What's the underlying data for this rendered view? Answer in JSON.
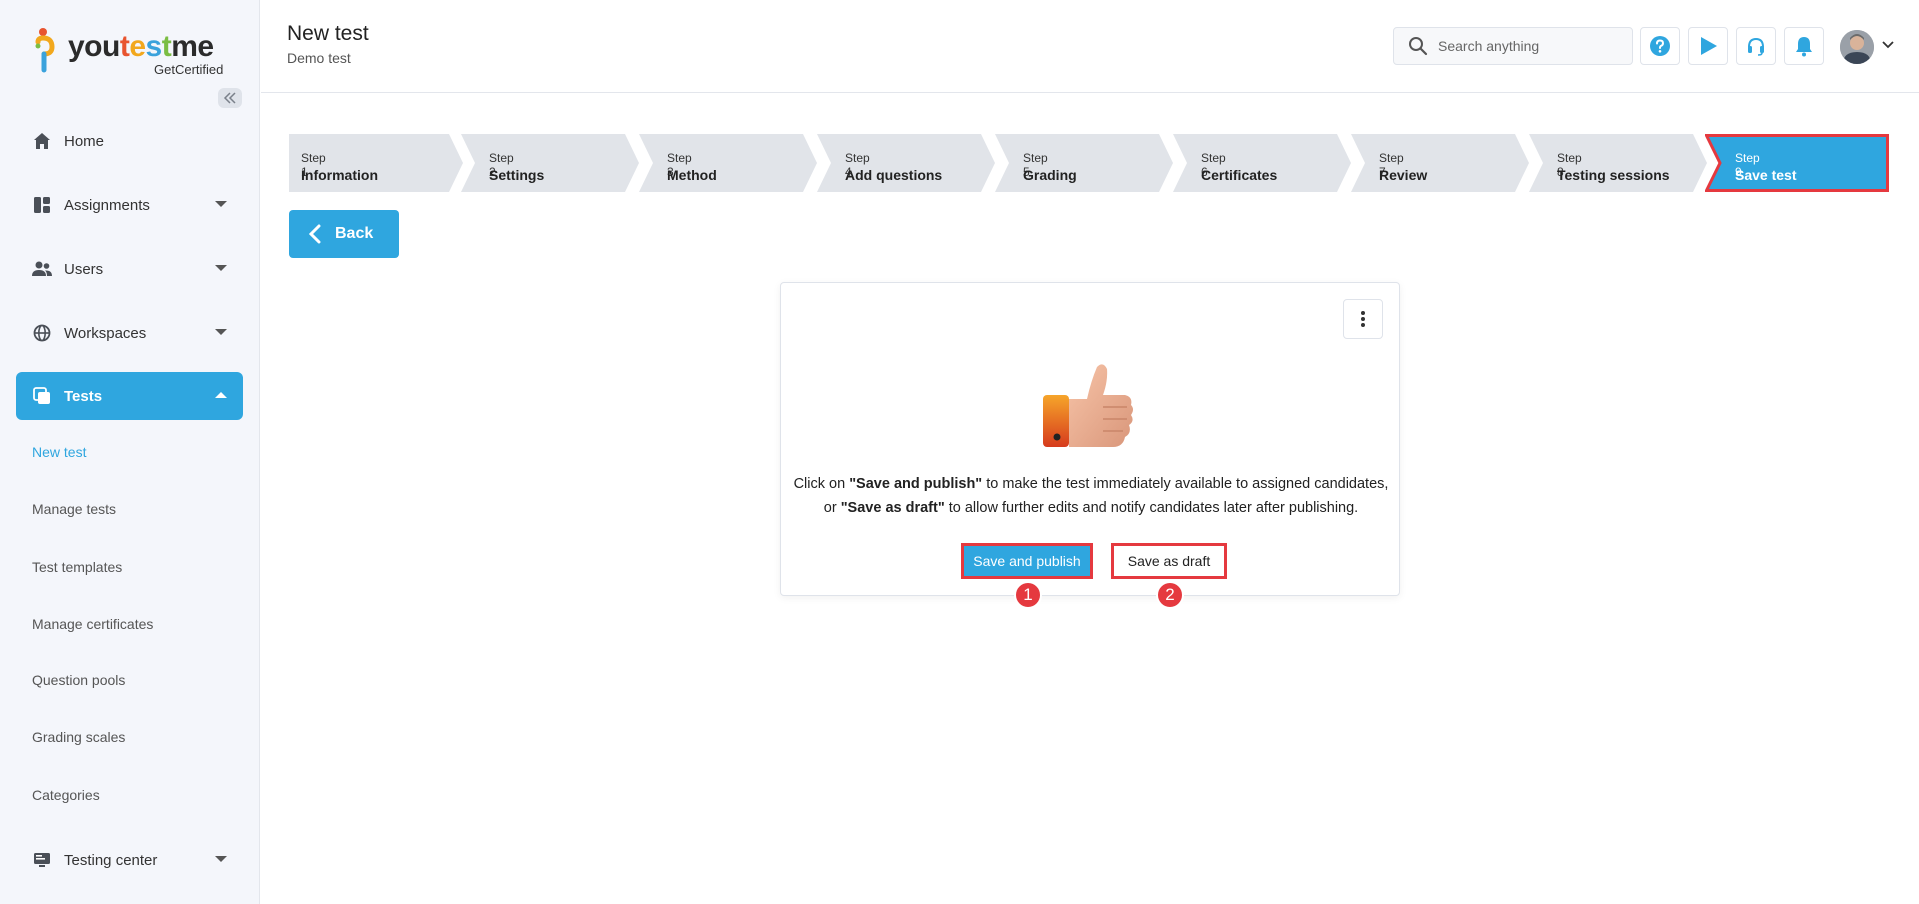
{
  "logo": {
    "text_you": "you",
    "text_t": "t",
    "text_e": "e",
    "text_s": "s",
    "text_t2": "t",
    "text_me": "me",
    "sub": "GetCertified"
  },
  "sidebar": {
    "items": [
      {
        "label": "Home",
        "icon": "home-icon"
      },
      {
        "label": "Assignments",
        "icon": "dashboard-icon"
      },
      {
        "label": "Users",
        "icon": "users-icon"
      },
      {
        "label": "Workspaces",
        "icon": "globe-icon"
      },
      {
        "label": "Tests",
        "icon": "copy-icon"
      },
      {
        "label": "Testing center",
        "icon": "monitor-icon"
      }
    ],
    "sub_items": [
      "New test",
      "Manage tests",
      "Test templates",
      "Manage certificates",
      "Question pools",
      "Grading scales",
      "Categories"
    ]
  },
  "header": {
    "title": "New test",
    "subtitle": "Demo test",
    "search_placeholder": "Search anything"
  },
  "stepper": {
    "steps": [
      {
        "num": "Step 1",
        "label": "Information"
      },
      {
        "num": "Step 2",
        "label": "Settings"
      },
      {
        "num": "Step 3",
        "label": "Method"
      },
      {
        "num": "Step 4",
        "label": "Add questions"
      },
      {
        "num": "Step 5",
        "label": "Grading"
      },
      {
        "num": "Step 6",
        "label": "Certificates"
      },
      {
        "num": "Step 7",
        "label": "Review"
      },
      {
        "num": "Step 8",
        "label": "Testing sessions"
      },
      {
        "num": "Step 9",
        "label": "Save test"
      }
    ],
    "active_index": 8
  },
  "back_label": "Back",
  "card": {
    "line1_pre": "Click on ",
    "line1_bold": "\"Save and publish\"",
    "line1_post": " to make the test immediately available to assigned candidates,",
    "line2_pre": "or ",
    "line2_bold": "\"Save as draft\"",
    "line2_post": " to allow further edits and notify candidates later after publishing.",
    "publish_label": "Save and publish",
    "draft_label": "Save as draft",
    "badge1": "1",
    "badge2": "2"
  },
  "colors": {
    "accent": "#2fa6df",
    "highlight": "#e5393f",
    "step_bg": "#e1e4e9"
  }
}
